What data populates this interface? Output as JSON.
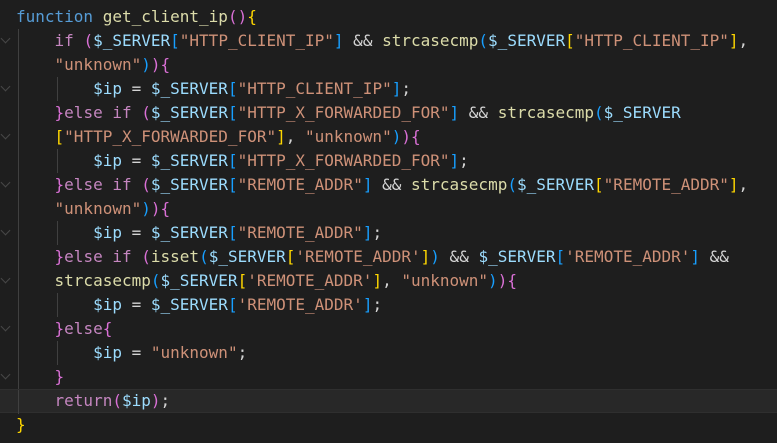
{
  "colors": {
    "background": "#1e1e1e",
    "keyword": "#569cd6",
    "control": "#c586c0",
    "function_name": "#dcdcaa",
    "variable": "#9cdcfe",
    "string": "#ce9178",
    "punct": "#d4d4d4",
    "bracket_gold": "#ffd700",
    "bracket_pink": "#da70d6",
    "bracket_blue": "#179fff"
  },
  "editor": {
    "lines": [
      {
        "tokens": [
          {
            "t": "function",
            "c": "keyword"
          },
          {
            "t": " ",
            "c": "punct"
          },
          {
            "t": "get_client_ip",
            "c": "function_name"
          },
          {
            "t": "()",
            "c": "bracket_pink"
          },
          {
            "t": "{",
            "c": "bracket_gold"
          }
        ]
      },
      {
        "tokens": [
          {
            "t": "    ",
            "c": "punct"
          },
          {
            "t": "if",
            "c": "control"
          },
          {
            "t": " ",
            "c": "punct"
          },
          {
            "t": "(",
            "c": "bracket_pink"
          },
          {
            "t": "$_SERVER",
            "c": "variable"
          },
          {
            "t": "[",
            "c": "bracket_blue"
          },
          {
            "t": "\"HTTP_CLIENT_IP\"",
            "c": "string"
          },
          {
            "t": "]",
            "c": "bracket_blue"
          },
          {
            "t": " && ",
            "c": "punct"
          },
          {
            "t": "strcasecmp",
            "c": "function_name"
          },
          {
            "t": "(",
            "c": "bracket_blue"
          },
          {
            "t": "$_SERVER",
            "c": "variable"
          },
          {
            "t": "[",
            "c": "bracket_gold"
          },
          {
            "t": "\"HTTP_CLIENT_IP\"",
            "c": "string"
          },
          {
            "t": "]",
            "c": "bracket_gold"
          },
          {
            "t": ",",
            "c": "punct"
          }
        ]
      },
      {
        "tokens": [
          {
            "t": "    ",
            "c": "punct"
          },
          {
            "t": "\"unknown\"",
            "c": "string"
          },
          {
            "t": ")",
            "c": "bracket_blue"
          },
          {
            "t": ")",
            "c": "bracket_pink"
          },
          {
            "t": "{",
            "c": "bracket_pink"
          }
        ]
      },
      {
        "tokens": [
          {
            "t": "        ",
            "c": "punct"
          },
          {
            "t": "$ip",
            "c": "variable"
          },
          {
            "t": " = ",
            "c": "punct"
          },
          {
            "t": "$_SERVER",
            "c": "variable"
          },
          {
            "t": "[",
            "c": "bracket_blue"
          },
          {
            "t": "\"HTTP_CLIENT_IP\"",
            "c": "string"
          },
          {
            "t": "]",
            "c": "bracket_blue"
          },
          {
            "t": ";",
            "c": "punct"
          }
        ]
      },
      {
        "tokens": [
          {
            "t": "    ",
            "c": "punct"
          },
          {
            "t": "}",
            "c": "bracket_pink"
          },
          {
            "t": "else",
            "c": "control"
          },
          {
            "t": " ",
            "c": "punct"
          },
          {
            "t": "if",
            "c": "control"
          },
          {
            "t": " ",
            "c": "punct"
          },
          {
            "t": "(",
            "c": "bracket_pink"
          },
          {
            "t": "$_SERVER",
            "c": "variable"
          },
          {
            "t": "[",
            "c": "bracket_blue"
          },
          {
            "t": "\"HTTP_X_FORWARDED_FOR\"",
            "c": "string"
          },
          {
            "t": "]",
            "c": "bracket_blue"
          },
          {
            "t": " && ",
            "c": "punct"
          },
          {
            "t": "strcasecmp",
            "c": "function_name"
          },
          {
            "t": "(",
            "c": "bracket_blue"
          },
          {
            "t": "$_SERVER",
            "c": "variable"
          }
        ]
      },
      {
        "tokens": [
          {
            "t": "    ",
            "c": "punct"
          },
          {
            "t": "[",
            "c": "bracket_gold"
          },
          {
            "t": "\"HTTP_X_FORWARDED_FOR\"",
            "c": "string"
          },
          {
            "t": "]",
            "c": "bracket_gold"
          },
          {
            "t": ", ",
            "c": "punct"
          },
          {
            "t": "\"unknown\"",
            "c": "string"
          },
          {
            "t": ")",
            "c": "bracket_blue"
          },
          {
            "t": ")",
            "c": "bracket_pink"
          },
          {
            "t": "{",
            "c": "bracket_pink"
          }
        ]
      },
      {
        "tokens": [
          {
            "t": "        ",
            "c": "punct"
          },
          {
            "t": "$ip",
            "c": "variable"
          },
          {
            "t": " = ",
            "c": "punct"
          },
          {
            "t": "$_SERVER",
            "c": "variable"
          },
          {
            "t": "[",
            "c": "bracket_blue"
          },
          {
            "t": "\"HTTP_X_FORWARDED_FOR\"",
            "c": "string"
          },
          {
            "t": "]",
            "c": "bracket_blue"
          },
          {
            "t": ";",
            "c": "punct"
          }
        ]
      },
      {
        "tokens": [
          {
            "t": "    ",
            "c": "punct"
          },
          {
            "t": "}",
            "c": "bracket_pink"
          },
          {
            "t": "else",
            "c": "control"
          },
          {
            "t": " ",
            "c": "punct"
          },
          {
            "t": "if",
            "c": "control"
          },
          {
            "t": " ",
            "c": "punct"
          },
          {
            "t": "(",
            "c": "bracket_pink"
          },
          {
            "t": "$_SERVER",
            "c": "variable"
          },
          {
            "t": "[",
            "c": "bracket_blue"
          },
          {
            "t": "\"REMOTE_ADDR\"",
            "c": "string"
          },
          {
            "t": "]",
            "c": "bracket_blue"
          },
          {
            "t": " && ",
            "c": "punct"
          },
          {
            "t": "strcasecmp",
            "c": "function_name"
          },
          {
            "t": "(",
            "c": "bracket_blue"
          },
          {
            "t": "$_SERVER",
            "c": "variable"
          },
          {
            "t": "[",
            "c": "bracket_gold"
          },
          {
            "t": "\"REMOTE_ADDR\"",
            "c": "string"
          },
          {
            "t": "]",
            "c": "bracket_gold"
          },
          {
            "t": ",",
            "c": "punct"
          }
        ]
      },
      {
        "tokens": [
          {
            "t": "    ",
            "c": "punct"
          },
          {
            "t": "\"unknown\"",
            "c": "string"
          },
          {
            "t": ")",
            "c": "bracket_blue"
          },
          {
            "t": ")",
            "c": "bracket_pink"
          },
          {
            "t": "{",
            "c": "bracket_pink"
          }
        ]
      },
      {
        "tokens": [
          {
            "t": "        ",
            "c": "punct"
          },
          {
            "t": "$ip",
            "c": "variable"
          },
          {
            "t": " = ",
            "c": "punct"
          },
          {
            "t": "$_SERVER",
            "c": "variable"
          },
          {
            "t": "[",
            "c": "bracket_blue"
          },
          {
            "t": "\"REMOTE_ADDR\"",
            "c": "string"
          },
          {
            "t": "]",
            "c": "bracket_blue"
          },
          {
            "t": ";",
            "c": "punct"
          }
        ]
      },
      {
        "tokens": [
          {
            "t": "    ",
            "c": "punct"
          },
          {
            "t": "}",
            "c": "bracket_pink"
          },
          {
            "t": "else",
            "c": "control"
          },
          {
            "t": " ",
            "c": "punct"
          },
          {
            "t": "if",
            "c": "control"
          },
          {
            "t": " ",
            "c": "punct"
          },
          {
            "t": "(",
            "c": "bracket_pink"
          },
          {
            "t": "isset",
            "c": "function_name"
          },
          {
            "t": "(",
            "c": "bracket_blue"
          },
          {
            "t": "$_SERVER",
            "c": "variable"
          },
          {
            "t": "[",
            "c": "bracket_gold"
          },
          {
            "t": "'REMOTE_ADDR'",
            "c": "string"
          },
          {
            "t": "]",
            "c": "bracket_gold"
          },
          {
            "t": ")",
            "c": "bracket_blue"
          },
          {
            "t": " && ",
            "c": "punct"
          },
          {
            "t": "$_SERVER",
            "c": "variable"
          },
          {
            "t": "[",
            "c": "bracket_blue"
          },
          {
            "t": "'REMOTE_ADDR'",
            "c": "string"
          },
          {
            "t": "]",
            "c": "bracket_blue"
          },
          {
            "t": " &&",
            "c": "punct"
          }
        ]
      },
      {
        "tokens": [
          {
            "t": "    ",
            "c": "punct"
          },
          {
            "t": "strcasecmp",
            "c": "function_name"
          },
          {
            "t": "(",
            "c": "bracket_blue"
          },
          {
            "t": "$_SERVER",
            "c": "variable"
          },
          {
            "t": "[",
            "c": "bracket_gold"
          },
          {
            "t": "'REMOTE_ADDR'",
            "c": "string"
          },
          {
            "t": "]",
            "c": "bracket_gold"
          },
          {
            "t": ", ",
            "c": "punct"
          },
          {
            "t": "\"unknown\"",
            "c": "string"
          },
          {
            "t": ")",
            "c": "bracket_blue"
          },
          {
            "t": ")",
            "c": "bracket_pink"
          },
          {
            "t": "{",
            "c": "bracket_pink"
          }
        ]
      },
      {
        "tokens": [
          {
            "t": "        ",
            "c": "punct"
          },
          {
            "t": "$ip",
            "c": "variable"
          },
          {
            "t": " = ",
            "c": "punct"
          },
          {
            "t": "$_SERVER",
            "c": "variable"
          },
          {
            "t": "[",
            "c": "bracket_blue"
          },
          {
            "t": "'REMOTE_ADDR'",
            "c": "string"
          },
          {
            "t": "]",
            "c": "bracket_blue"
          },
          {
            "t": ";",
            "c": "punct"
          }
        ]
      },
      {
        "tokens": [
          {
            "t": "    ",
            "c": "punct"
          },
          {
            "t": "}",
            "c": "bracket_pink"
          },
          {
            "t": "else",
            "c": "control"
          },
          {
            "t": "{",
            "c": "bracket_pink"
          }
        ]
      },
      {
        "tokens": [
          {
            "t": "        ",
            "c": "punct"
          },
          {
            "t": "$ip",
            "c": "variable"
          },
          {
            "t": " = ",
            "c": "punct"
          },
          {
            "t": "\"unknown\"",
            "c": "string"
          },
          {
            "t": ";",
            "c": "punct"
          }
        ]
      },
      {
        "tokens": [
          {
            "t": "    ",
            "c": "punct"
          },
          {
            "t": "}",
            "c": "bracket_pink"
          }
        ]
      },
      {
        "tokens": [
          {
            "t": "    ",
            "c": "punct"
          },
          {
            "t": "return",
            "c": "control"
          },
          {
            "t": "(",
            "c": "bracket_pink"
          },
          {
            "t": "$ip",
            "c": "variable"
          },
          {
            "t": ")",
            "c": "bracket_pink"
          },
          {
            "t": ";",
            "c": "punct"
          }
        ]
      },
      {
        "tokens": [
          {
            "t": "}",
            "c": "bracket_gold"
          }
        ]
      }
    ]
  }
}
